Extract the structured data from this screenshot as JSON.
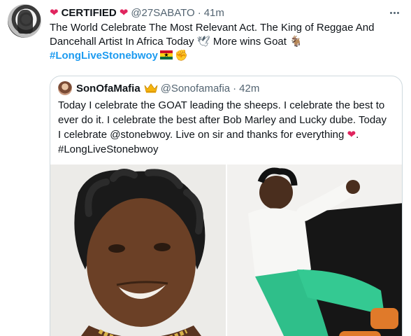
{
  "tweet": {
    "author": {
      "name": "CERTIFIED",
      "handle": "@27SABATO",
      "time": "41m",
      "separator": "·"
    },
    "text_lines": [
      "The World Celebrate The Most Relevant Act. The King of Reggae And",
      "Dancehall Artist In Africa Today",
      "More wins Goat"
    ],
    "hashtag": "#LongLiveStonebwoy",
    "icons": {
      "heart_before_name": "red-heart-icon",
      "heart_after_name": "red-heart-icon",
      "dove": "dove-icon",
      "goat": "goat-icon",
      "flag": "ghana-flag-icon",
      "fist": "fist-icon",
      "more": "more-options-icon"
    },
    "colors": {
      "heart": "#e0245e",
      "link": "#1d9bf0",
      "secondary_text": "#536471",
      "border": "#cfd9de"
    }
  },
  "quote": {
    "author": {
      "name": "SonOfaMafia",
      "handle": "@Sonofamafia",
      "time": "42m",
      "separator": "·"
    },
    "text_lines": [
      "Today I celebrate the GOAT leading the sheeps. I celebrate the best to",
      "ever do it. I celebrate the best after Bob Marley and Lucky dube. Today",
      "I celebrate @stonebwoy. Live on sir and thanks for everything"
    ],
    "hashtag": "#LongLiveStonebwoy",
    "icons": {
      "crown": "crown-icon",
      "heart": "red-heart-icon"
    },
    "photos": [
      {
        "name": "photo-left",
        "subject": "close-up portrait of smiling man with dreadlocks and gold chain"
      },
      {
        "name": "photo-right",
        "subject": "man in white top and green pants sitting against black sofa"
      }
    ]
  }
}
